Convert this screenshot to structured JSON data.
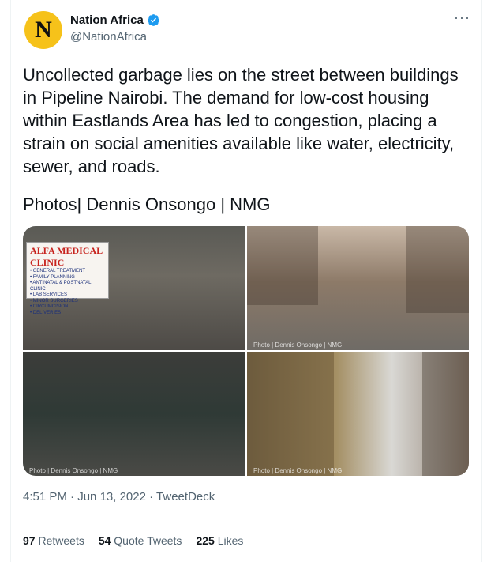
{
  "author": {
    "avatar_letter": "N",
    "display_name": "Nation Africa",
    "handle": "@NationAfrica",
    "verified_icon": "verified-badge-icon",
    "brand_color": "#f6c21a"
  },
  "tweet": {
    "text": "Uncollected garbage lies on the street between buildings in Pipeline Nairobi. The demand for low-cost housing within Eastlands Area has led to congestion, placing a strain on social amenities available like water, electricity, sewer, and roads.",
    "credit": "Photos| Dennis Onsongo | NMG"
  },
  "photos": {
    "sign": {
      "title": "ALFA MEDICAL CLINIC",
      "lines": [
        "• GENERAL TREATMENT",
        "• FAMILY PLANNING",
        "• ANTINATAL & POSTNATAL CLINIC",
        "• LAB SERVICES",
        "• MINOR SURGERIES",
        "• CIRCUMCISION",
        "• DELIVERIES"
      ]
    },
    "watermark": "Photo | Dennis Onsongo | NMG"
  },
  "meta": {
    "time": "4:51 PM",
    "date": "Jun 13, 2022",
    "separator": "·",
    "source": "TweetDeck"
  },
  "stats": {
    "retweets_count": "97",
    "retweets_label": "Retweets",
    "quotes_count": "54",
    "quotes_label": "Quote Tweets",
    "likes_count": "225",
    "likes_label": "Likes"
  },
  "more_icon": "more-options-icon",
  "accent": "#1d9bf0"
}
